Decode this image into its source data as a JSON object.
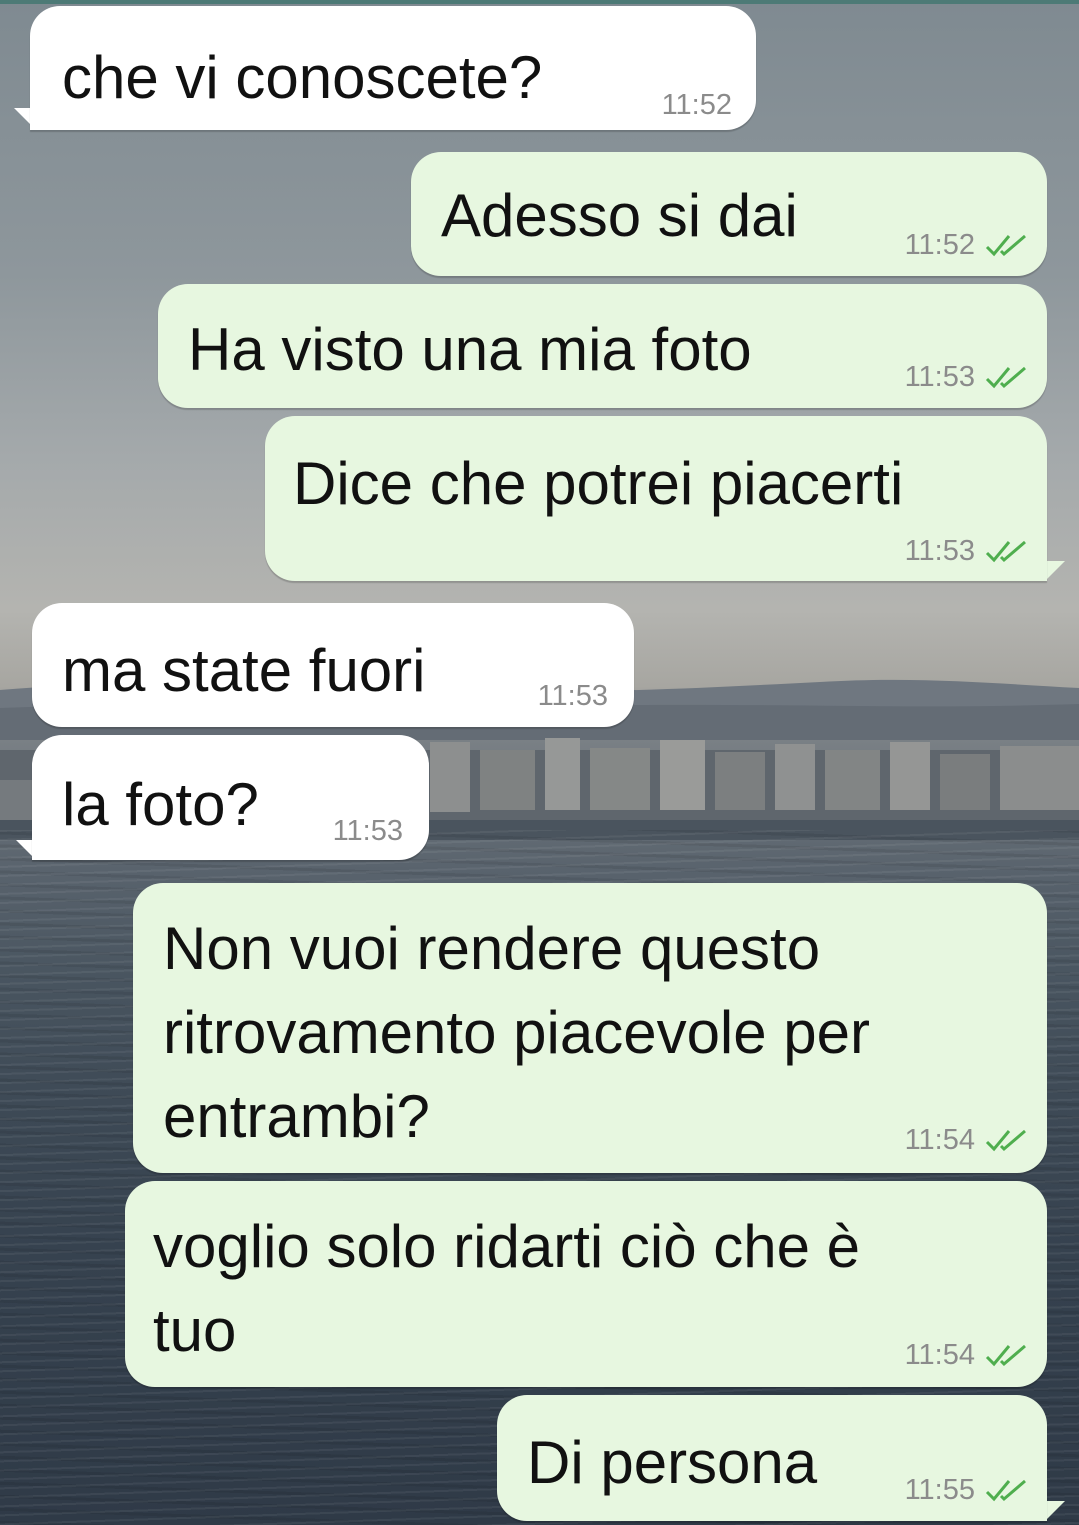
{
  "colors": {
    "incoming_bubble": "#ffffff",
    "outgoing_bubble": "#e7f7e0",
    "read_ticks": "#4fae4e",
    "timestamp": "#8b8b8b"
  },
  "messages": [
    {
      "direction": "in",
      "text": "che vi conoscete?",
      "time": "11:52"
    },
    {
      "direction": "out",
      "text": "Adesso si dai",
      "time": "11:52",
      "status_icon": "double-check-icon"
    },
    {
      "direction": "out",
      "text": "Ha visto una mia foto",
      "time": "11:53",
      "status_icon": "double-check-icon"
    },
    {
      "direction": "out",
      "text": "Dice che potrei piacerti",
      "time": "11:53",
      "status_icon": "double-check-icon"
    },
    {
      "direction": "in",
      "text": "ma state fuori",
      "time": "11:53"
    },
    {
      "direction": "in",
      "text": "la foto?",
      "time": "11:53"
    },
    {
      "direction": "out",
      "text": "Non vuoi rendere questo\nritrovamento piacevole per\nentrambi?",
      "time": "11:54",
      "status_icon": "double-check-icon"
    },
    {
      "direction": "out",
      "text": "voglio solo ridarti ciò che è\ntuo",
      "time": "11:54",
      "status_icon": "double-check-icon"
    },
    {
      "direction": "out",
      "text": "Di persona",
      "time": "11:55",
      "status_icon": "double-check-icon"
    }
  ]
}
